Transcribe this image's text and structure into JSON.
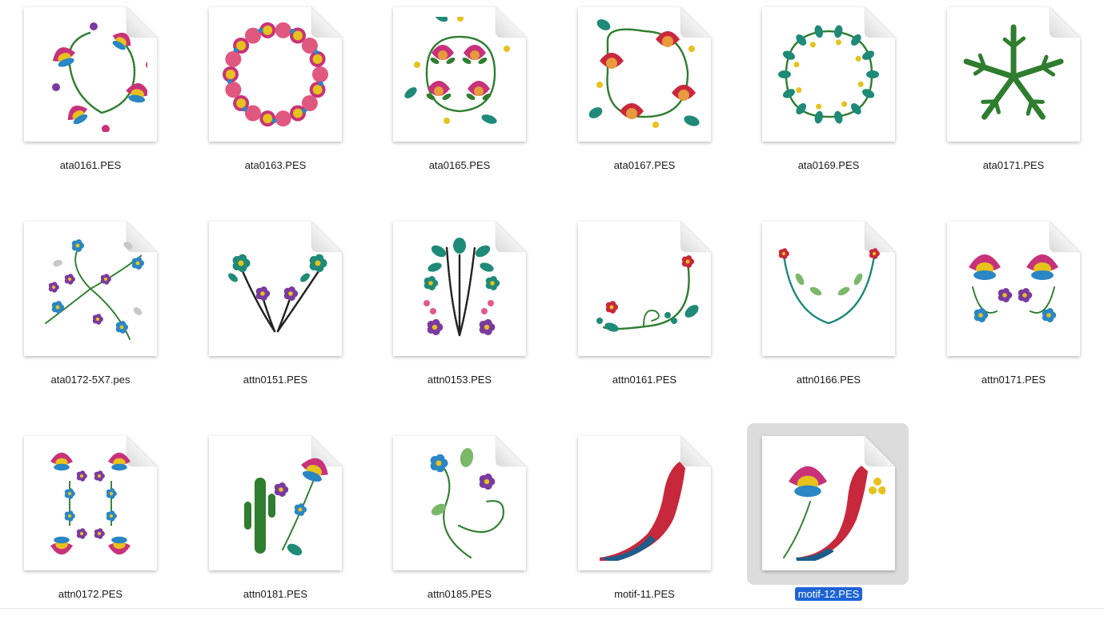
{
  "files": [
    {
      "name": "ata0161.PES",
      "icon": "embroidery-flower-wreath"
    },
    {
      "name": "ata0163.PES",
      "icon": "embroidery-round-wreath"
    },
    {
      "name": "ata0165.PES",
      "icon": "embroidery-pomegranate-circle"
    },
    {
      "name": "ata0167.PES",
      "icon": "embroidery-pomegranate-square"
    },
    {
      "name": "ata0169.PES",
      "icon": "embroidery-leaf-wreath"
    },
    {
      "name": "ata0171.PES",
      "icon": "embroidery-cactus-star"
    },
    {
      "name": "ata0172-5X7.pes",
      "icon": "embroidery-swirl-flowers"
    },
    {
      "name": "attn0151.PES",
      "icon": "embroidery-v-flowers"
    },
    {
      "name": "attn0153.PES",
      "icon": "embroidery-tree-flowers"
    },
    {
      "name": "attn0161.PES",
      "icon": "embroidery-corner-vine"
    },
    {
      "name": "attn0166.PES",
      "icon": "embroidery-u-vine"
    },
    {
      "name": "attn0171.PES",
      "icon": "embroidery-mirror-flowers"
    },
    {
      "name": "attn0172.PES",
      "icon": "embroidery-border-flowers"
    },
    {
      "name": "attn0181.PES",
      "icon": "embroidery-cactus-flower"
    },
    {
      "name": "attn0185.PES",
      "icon": "embroidery-spiral-flowers"
    },
    {
      "name": "motif-11.PES",
      "icon": "embroidery-chili-pepper"
    },
    {
      "name": "motif-12.PES",
      "icon": "embroidery-flower-pepper",
      "selected": true
    }
  ],
  "colors": {
    "selection_label_bg": "#1e63d6",
    "selection_tile_bg": "#dcdcdc",
    "magenta": "#c8327a",
    "yellow": "#e6c21c",
    "teal": "#1f8a78",
    "green": "#2f7d2f",
    "blue": "#2a86c4",
    "purple": "#7a3aa0",
    "red": "#c8283c"
  }
}
